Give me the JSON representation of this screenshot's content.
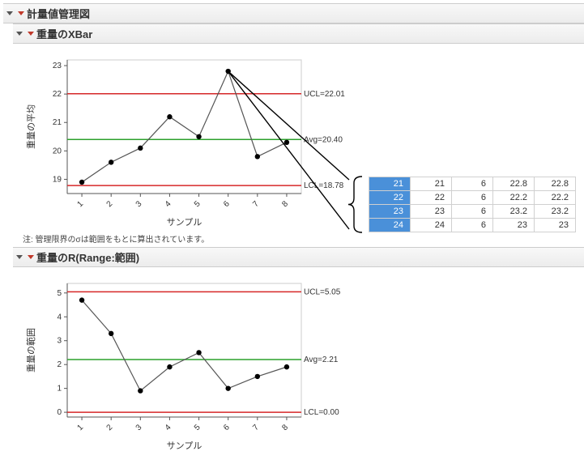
{
  "titles": {
    "main": "計量値管理図",
    "xbar": "重量のXBar",
    "r": "重量のR(Range:範囲)"
  },
  "note": "注: 管理限界のσは範囲をもとに算出されています。",
  "axis": {
    "x_label": "サンプル"
  },
  "xbar": {
    "y_label": "重量の平均",
    "ucl_label": "UCL=22.01",
    "avg_label": "Avg=20.40",
    "lcl_label": "LCL=18.78"
  },
  "r": {
    "y_label": "重量の範囲",
    "ucl_label": "UCL=5.05",
    "avg_label": "Avg=2.21",
    "lcl_label": "LCL=0.00"
  },
  "chart_data": [
    {
      "type": "line",
      "name": "XBar",
      "xlabel": "サンプル",
      "ylabel": "重量の平均",
      "categories": [
        1,
        2,
        3,
        4,
        5,
        6,
        7,
        8
      ],
      "values": [
        18.9,
        19.6,
        20.1,
        21.2,
        20.5,
        22.8,
        19.8,
        20.3
      ],
      "yticks": [
        19,
        20,
        21,
        22,
        23
      ],
      "ylim": [
        18.5,
        23.2
      ],
      "ucl": 22.01,
      "avg": 20.4,
      "lcl": 18.78
    },
    {
      "type": "line",
      "name": "R",
      "xlabel": "サンプル",
      "ylabel": "重量の範囲",
      "categories": [
        1,
        2,
        3,
        4,
        5,
        6,
        7,
        8
      ],
      "values": [
        4.7,
        3.3,
        0.9,
        1.9,
        2.5,
        1.0,
        1.5,
        1.9
      ],
      "yticks": [
        0,
        1,
        2,
        3,
        4,
        5
      ],
      "ylim": [
        -0.2,
        5.4
      ],
      "ucl": 5.05,
      "avg": 2.21,
      "lcl": 0.0
    }
  ],
  "table": {
    "rows": [
      [
        "21",
        "21",
        "6",
        "22.8",
        "22.8"
      ],
      [
        "22",
        "22",
        "6",
        "22.2",
        "22.2"
      ],
      [
        "23",
        "23",
        "6",
        "23.2",
        "23.2"
      ],
      [
        "24",
        "24",
        "6",
        "23",
        "23"
      ]
    ]
  }
}
